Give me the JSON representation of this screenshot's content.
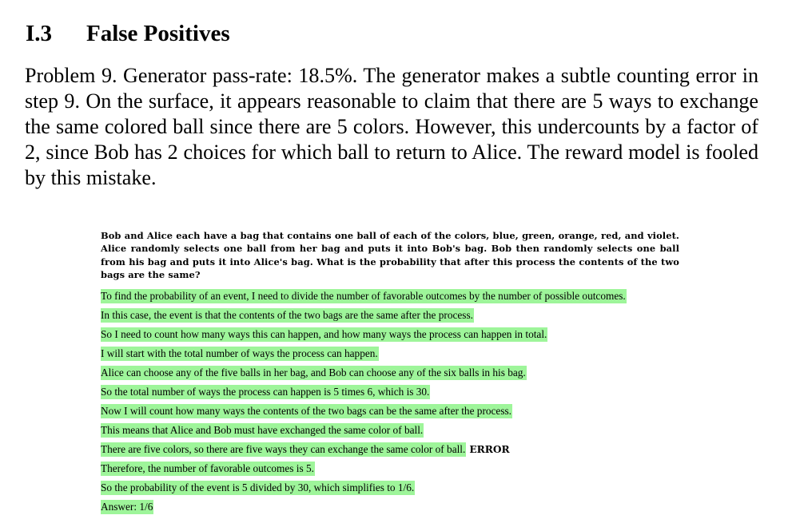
{
  "section": {
    "number": "I.3",
    "title": "False Positives"
  },
  "intro_paragraph": "Problem 9. Generator pass-rate: 18.5%. The generator makes a subtle counting error in step 9. On the surface, it appears reasonable to claim that there are 5 ways to exchange the same colored ball since there are 5 colors. However, this undercounts by a factor of 2, since Bob has 2 choices for which ball to return to Alice. The reward model is fooled by this mistake.",
  "figure": {
    "question": "Bob and Alice each have a bag that contains one ball of each of the colors, blue, green, orange, red, and violet. Alice randomly selects one ball from her bag and puts it into Bob's bag. Bob then randomly selects one ball from his bag and puts it into Alice's bag. What is the probability that after this process the contents of the two bags are the same?",
    "steps": [
      "To find the probability of an event, I need to divide the number of favorable outcomes by the number of possible outcomes.",
      "In this case, the event is that the contents of the two bags are the same after the process.",
      "So I need to count how many ways this can happen, and how many ways the process can happen in total.",
      "I will start with the total number of ways the process can happen.",
      "Alice can choose any of the five balls in her bag, and Bob can choose any of the six balls in his bag.",
      "So the total number of ways the process can happen is 5 times 6, which is 30.",
      "Now I will count how many ways the contents of the two bags can be the same after the process.",
      "This means that Alice and Bob must have exchanged the same color of ball.",
      "There are five colors, so there are five ways they can exchange the same color of ball.",
      "Therefore, the number of favorable outcomes is 5.",
      "So the probability of the event is 5 divided by 30, which simplifies to 1/6.",
      "Answer: 1/6"
    ],
    "error_label": "ERROR",
    "highlight_color": "#9ef59a"
  }
}
